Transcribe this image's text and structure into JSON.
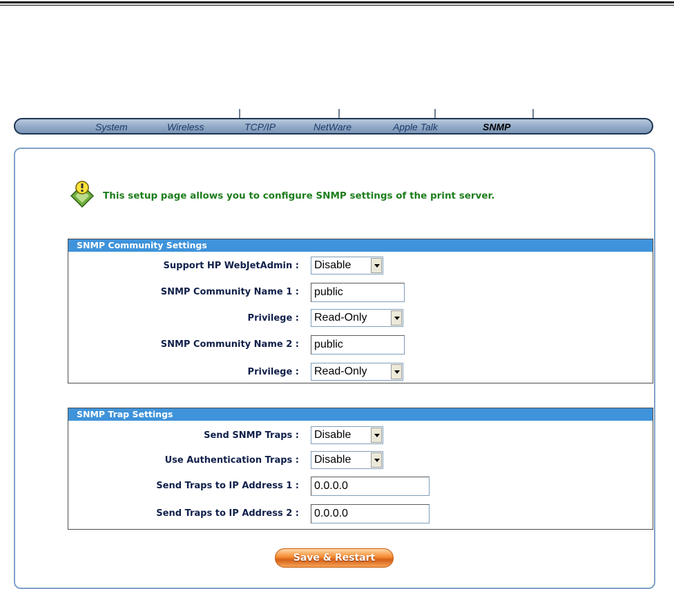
{
  "nav": {
    "items": [
      "System",
      "Wireless",
      "TCP/IP",
      "NetWare",
      "Apple Talk",
      "SNMP"
    ],
    "active": "SNMP"
  },
  "info": {
    "icon": "lightbulb-diamond-icon",
    "text": "This setup page allows you to configure SNMP settings of the print server."
  },
  "community": {
    "header": "SNMP Community Settings",
    "rows": [
      {
        "label": "Support HP WebJetAdmin :",
        "type": "select",
        "value": "Disable"
      },
      {
        "label": "SNMP Community Name 1 :",
        "type": "text",
        "value": "public"
      },
      {
        "label": "Privilege :",
        "type": "select",
        "value": "Read-Only"
      },
      {
        "label": "SNMP Community Name 2 :",
        "type": "text",
        "value": "public"
      },
      {
        "label": "Privilege :",
        "type": "select",
        "value": "Read-Only"
      }
    ]
  },
  "trap": {
    "header": "SNMP Trap Settings",
    "rows": [
      {
        "label": "Send SNMP Traps :",
        "type": "select",
        "value": "Disable"
      },
      {
        "label": "Use Authentication Traps :",
        "type": "select",
        "value": "Disable"
      },
      {
        "label": "Send Traps to IP Address 1 :",
        "type": "text",
        "value": "0.0.0.0"
      },
      {
        "label": "Send Traps to IP Address 2 :",
        "type": "text",
        "value": "0.0.0.0"
      }
    ]
  },
  "actions": {
    "save_label": "Save & Restart"
  },
  "colors": {
    "section_header": "#3f93da",
    "info_text": "#1d7d1d",
    "label": "#10204a",
    "nav_bar": "#8ea7c5",
    "save_button": "#f58a2e"
  }
}
